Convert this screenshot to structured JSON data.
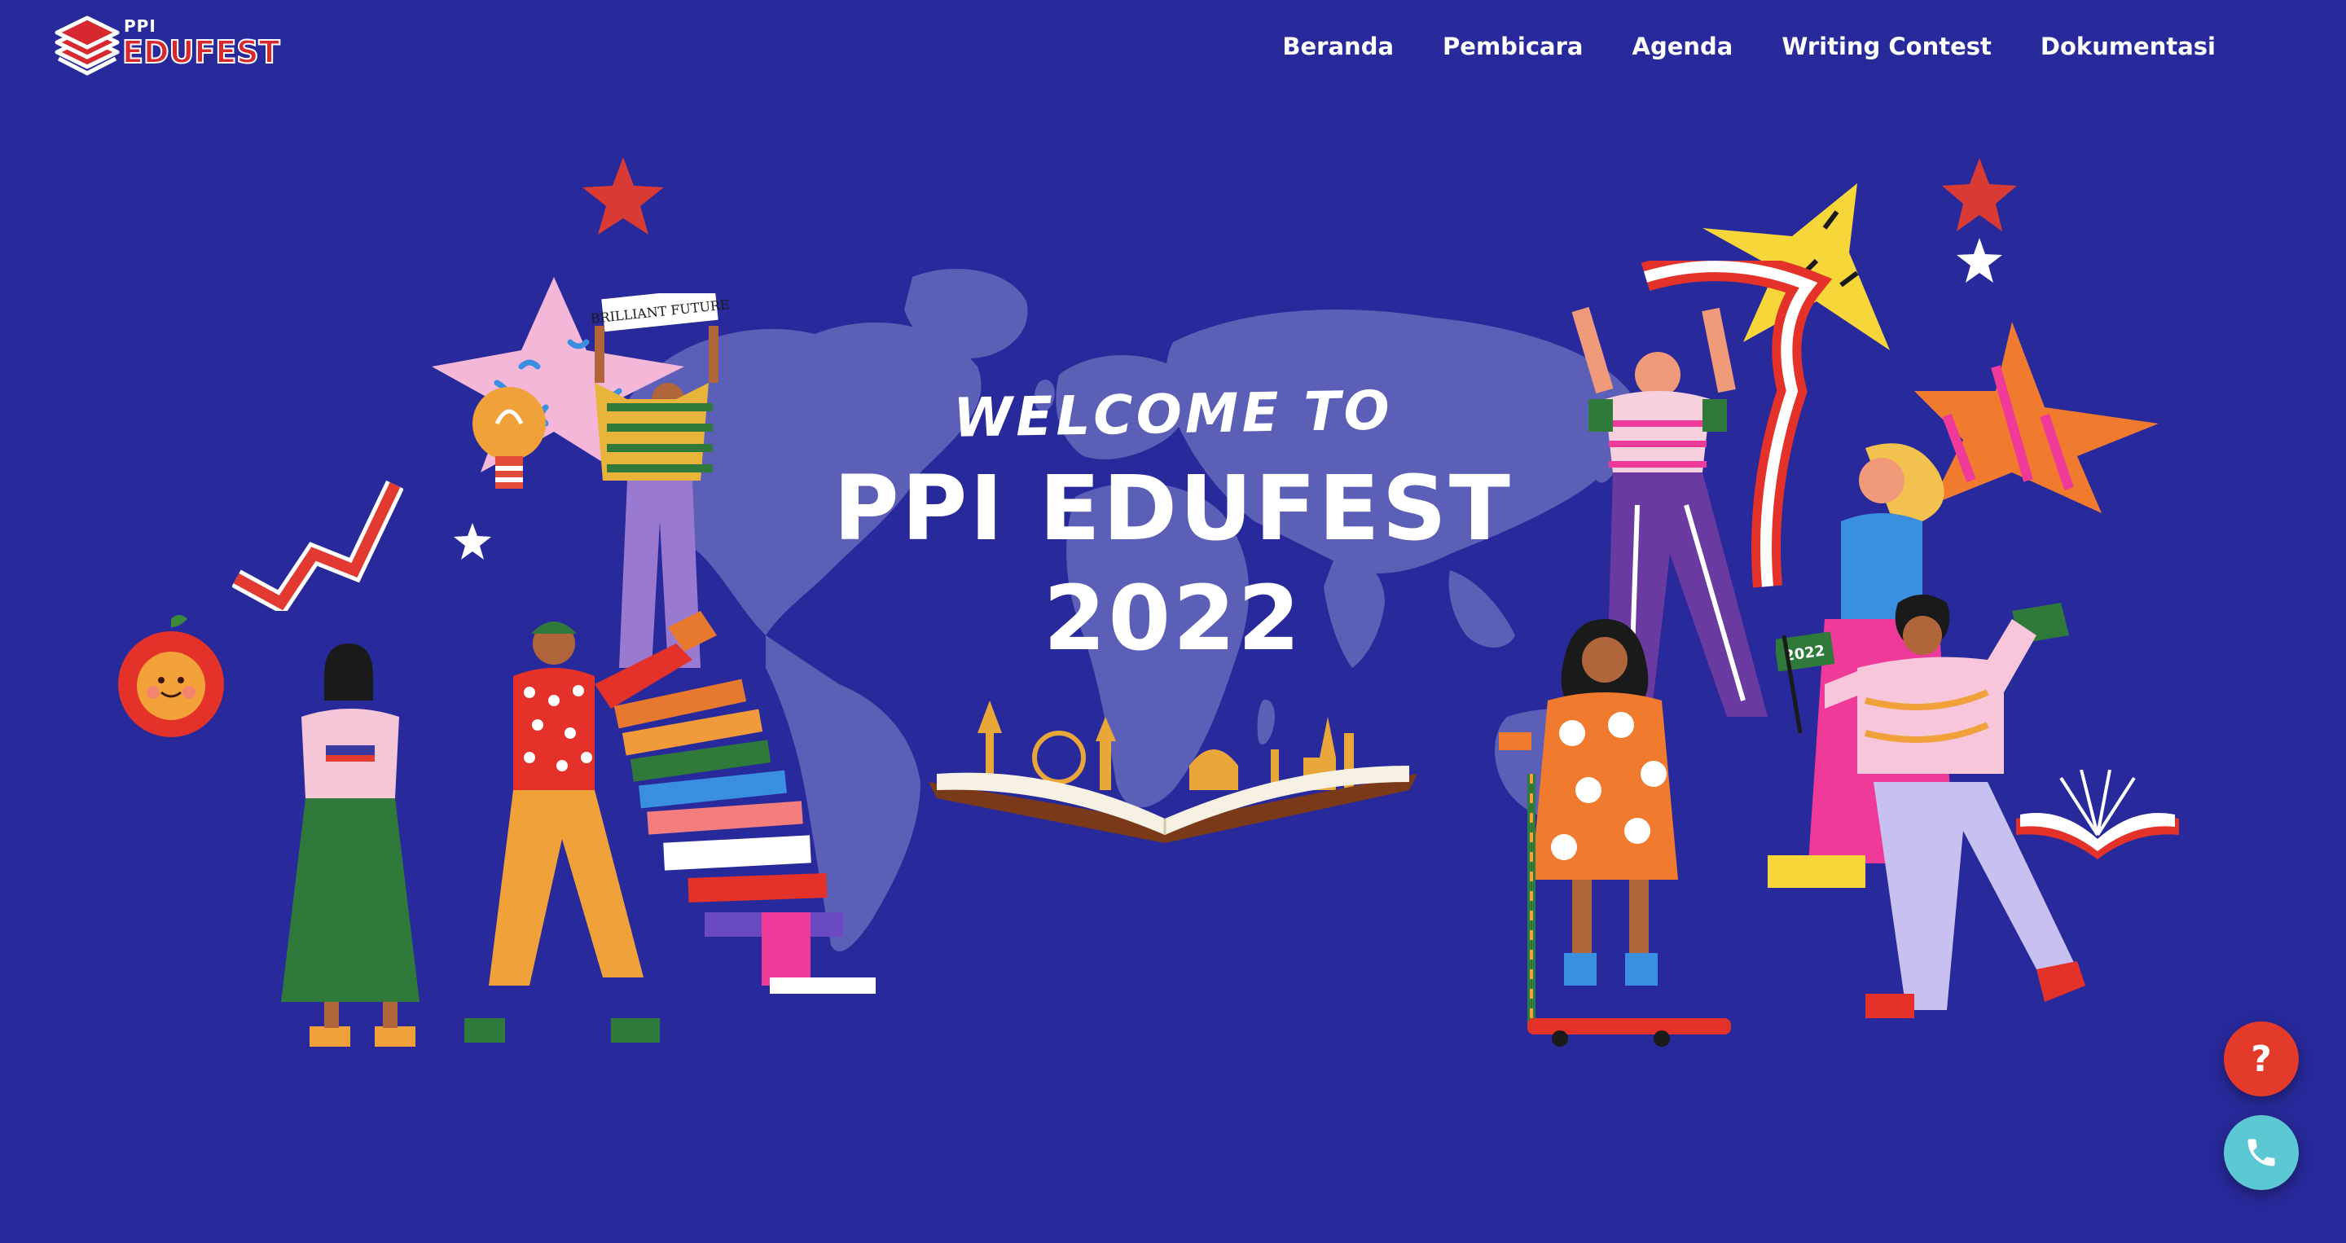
{
  "header": {
    "logo": {
      "small_text": "PPI",
      "large_text": "EDUFEST"
    },
    "nav": [
      {
        "label": "Beranda"
      },
      {
        "label": "Pembicara"
      },
      {
        "label": "Agenda"
      },
      {
        "label": "Writing Contest"
      },
      {
        "label": "Dokumentasi"
      }
    ]
  },
  "hero": {
    "welcome": "WELCOME TO",
    "event_name": "PPI EDUFEST",
    "year": "2022",
    "banner_sign": "BRILLIANT FUTURE",
    "flag_text": "2022"
  },
  "floating_buttons": {
    "help_label": "?",
    "call_icon": "phone-icon"
  },
  "colors": {
    "background": "#28299a",
    "map": "#5f62b8",
    "help_button": "#e33a2a",
    "call_button": "#5cc8d4",
    "logo_red": "#d7282f"
  }
}
